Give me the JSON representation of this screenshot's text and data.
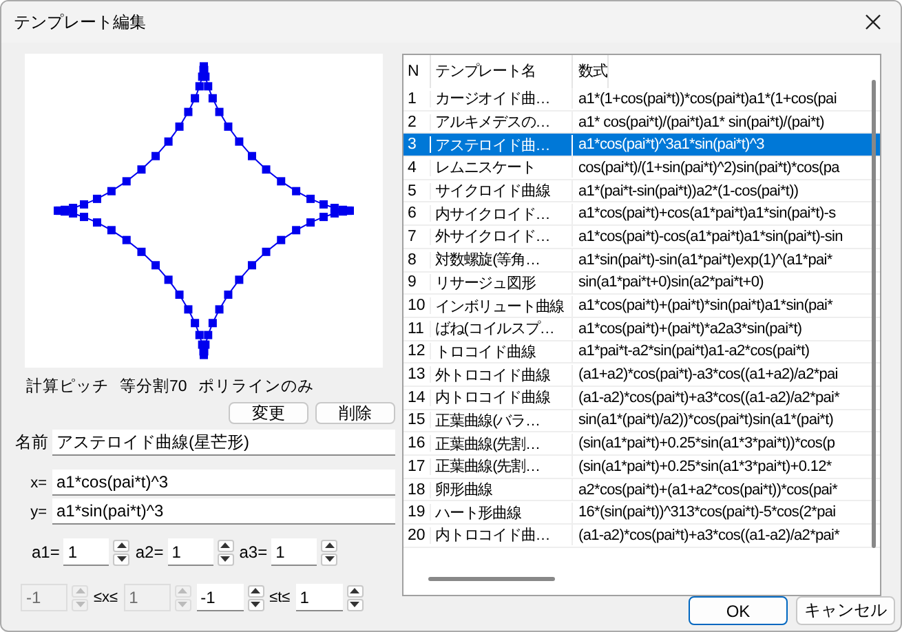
{
  "window": {
    "title": "テンプレート編集"
  },
  "preview": {
    "info": [
      "計算ピッチ",
      "等分割70",
      "ポリラインのみ"
    ]
  },
  "edit_buttons": [
    "変更",
    "削除"
  ],
  "name_field": {
    "label": "名前",
    "value": "アステロイド曲線(星芒形)"
  },
  "formulas": [
    {
      "label": "x=",
      "value": "a1*cos(pai*t)^3"
    },
    {
      "label": "y=",
      "value": "a1*sin(pai*t)^3"
    }
  ],
  "params": [
    {
      "label": "a1=",
      "value": "1"
    },
    {
      "label": "a2=",
      "value": "1"
    },
    {
      "label": "a3=",
      "value": "1"
    }
  ],
  "range": [
    {
      "kind": "field",
      "value": "-1",
      "disabled": true
    },
    {
      "kind": "label",
      "text": "≤x≤"
    },
    {
      "kind": "field",
      "value": "1",
      "disabled": true
    },
    {
      "kind": "field",
      "value": "-1",
      "disabled": false
    },
    {
      "kind": "label",
      "text": "≤t≤"
    },
    {
      "kind": "field",
      "value": "1",
      "disabled": false
    }
  ],
  "table": {
    "columns": [
      "N",
      "テンプレート名",
      "数式"
    ],
    "rows": [
      {
        "n": "1",
        "name": "カージオイド曲…",
        "formula": "a1*(1+cos(pai*t))*cos(pai*t)a1*(1+cos(pai",
        "selected": false
      },
      {
        "n": "2",
        "name": "アルキメデスの…",
        "formula": "a1* cos(pai*t)/(pai*t)a1* sin(pai*t)/(pai*t)",
        "selected": false
      },
      {
        "n": "3",
        "name": "アステロイド曲…",
        "formula": "a1*cos(pai*t)^3a1*sin(pai*t)^3",
        "selected": true
      },
      {
        "n": "4",
        "name": "レムニスケート",
        "formula": "cos(pai*t)/(1+sin(pai*t)^2)sin(pai*t)*cos(pa",
        "selected": false
      },
      {
        "n": "5",
        "name": "サイクロイド曲線",
        "formula": "a1*(pai*t-sin(pai*t))a2*(1-cos(pai*t))",
        "selected": false
      },
      {
        "n": "6",
        "name": "内サイクロイド…",
        "formula": "a1*cos(pai*t)+cos(a1*pai*t)a1*sin(pai*t)-s",
        "selected": false
      },
      {
        "n": "7",
        "name": "外サイクロイド…",
        "formula": "a1*cos(pai*t)-cos(a1*pai*t)a1*sin(pai*t)-sin",
        "selected": false
      },
      {
        "n": "8",
        "name": "対数螺旋(等角…",
        "formula": "a1*sin(pai*t)-sin(a1*pai*t)exp(1)^(a1*pai*",
        "selected": false
      },
      {
        "n": "9",
        "name": "リサージュ図形",
        "formula": "sin(a1*pai*t+0)sin(a2*pai*t+0)",
        "selected": false
      },
      {
        "n": "10",
        "name": "インボリュート曲線",
        "formula": "a1*cos(pai*t)+(pai*t)*sin(pai*t)a1*sin(pai*",
        "selected": false
      },
      {
        "n": "11",
        "name": "ばね(コイルスプ…",
        "formula": "a1*cos(pai*t)+(pai*t)*a2a3*sin(pai*t)",
        "selected": false
      },
      {
        "n": "12",
        "name": "トロコイド曲線",
        "formula": "a1*pai*t-a2*sin(pai*t)a1-a2*cos(pai*t)",
        "selected": false
      },
      {
        "n": "13",
        "name": "外トロコイド曲線",
        "formula": "(a1+a2)*cos(pai*t)-a3*cos((a1+a2)/a2*pai",
        "selected": false
      },
      {
        "n": "14",
        "name": "内トロコイド曲線",
        "formula": "(a1-a2)*cos(pai*t)+a3*cos((a1-a2)/a2*pai*",
        "selected": false
      },
      {
        "n": "15",
        "name": "正葉曲線(バラ…",
        "formula": "sin(a1*(pai*t)/a2))*cos(pai*t)sin(a1*(pai*t)",
        "selected": false
      },
      {
        "n": "16",
        "name": "正葉曲線(先割…",
        "formula": "(sin(a1*pai*t)+0.25*sin(a1*3*pai*t))*cos(p",
        "selected": false
      },
      {
        "n": "17",
        "name": "正葉曲線(先割…",
        "formula": "(sin(a1*pai*t)+0.25*sin(a1*3*pai*t)+0.12*",
        "selected": false
      },
      {
        "n": "18",
        "name": "卵形曲線",
        "formula": "a2*cos(pai*t)+(a1+a2*cos(pai*t))*cos(pai*",
        "selected": false
      },
      {
        "n": "19",
        "name": "ハート形曲線",
        "formula": "16*(sin(pai*t))^313*cos(pai*t)-5*cos(2*pai",
        "selected": false
      },
      {
        "n": "20",
        "name": "内トロコイド曲…",
        "formula": "(a1-a2)*cos(pai*t)+a3*cos((a1-a2)/a2*pai*",
        "selected": false
      }
    ]
  },
  "buttons": [
    {
      "label": "OK",
      "default": true
    },
    {
      "label": "キャンセル",
      "default": false
    }
  ]
}
